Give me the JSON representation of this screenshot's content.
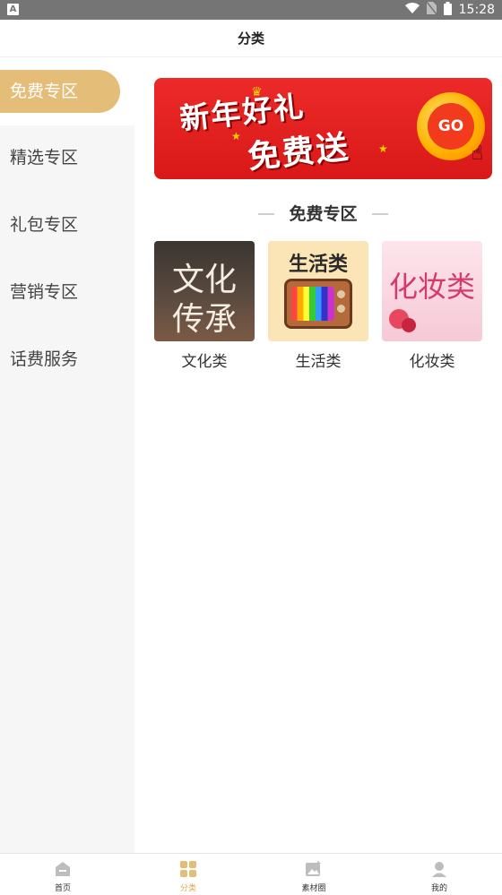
{
  "status_bar": {
    "time": "15:28",
    "left_icon": "A"
  },
  "header": {
    "title": "分类"
  },
  "sidebar": {
    "items": [
      {
        "label": "免费专区",
        "active": true
      },
      {
        "label": "精选专区",
        "active": false
      },
      {
        "label": "礼包专区",
        "active": false
      },
      {
        "label": "营销专区",
        "active": false
      },
      {
        "label": "话费服务",
        "active": false
      }
    ]
  },
  "banner": {
    "line1": "新年好礼",
    "line2": "免费送",
    "go_label": "GO"
  },
  "section": {
    "title": "免费专区",
    "categories": [
      {
        "name": "文化类",
        "thumb_line1": "文化",
        "thumb_line2": "传承"
      },
      {
        "name": "生活类",
        "thumb_title": "生活类"
      },
      {
        "name": "化妆类",
        "thumb_title": "化妆类"
      }
    ]
  },
  "tabbar": {
    "tabs": [
      {
        "label": "首页",
        "icon": "home-icon"
      },
      {
        "label": "分类",
        "icon": "category-icon",
        "active": true
      },
      {
        "label": "素材圈",
        "icon": "image-icon"
      },
      {
        "label": "我的",
        "icon": "user-icon"
      }
    ]
  },
  "colors": {
    "accent": "#e4bd78",
    "active_tab": "#d9a94e",
    "banner_red": "#e52222"
  }
}
